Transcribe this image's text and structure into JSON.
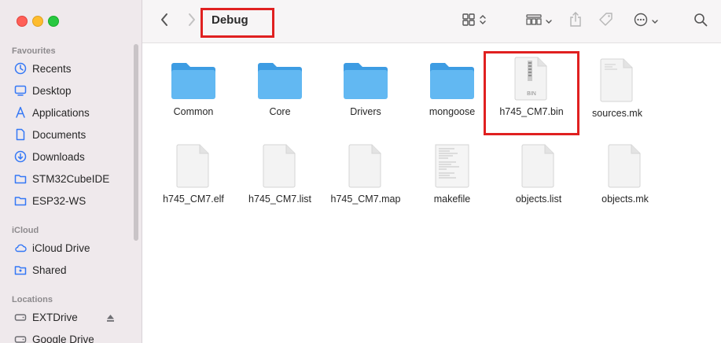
{
  "window": {
    "title": "Debug"
  },
  "sidebar": {
    "favourites_title": "Favourites",
    "favourites": [
      {
        "label": "Recents",
        "icon": "clock-icon"
      },
      {
        "label": "Desktop",
        "icon": "desktop-icon"
      },
      {
        "label": "Applications",
        "icon": "applications-icon"
      },
      {
        "label": "Documents",
        "icon": "document-icon"
      },
      {
        "label": "Downloads",
        "icon": "downloads-icon"
      },
      {
        "label": "STM32CubeIDE",
        "icon": "folder-icon"
      },
      {
        "label": "ESP32-WS",
        "icon": "folder-icon"
      }
    ],
    "icloud_title": "iCloud",
    "icloud": [
      {
        "label": "iCloud Drive",
        "icon": "cloud-icon"
      },
      {
        "label": "Shared",
        "icon": "shared-folder-icon"
      }
    ],
    "locations_title": "Locations",
    "locations": [
      {
        "label": "EXTDrive",
        "icon": "drive-icon"
      },
      {
        "label": "Google Drive",
        "icon": "drive-icon"
      }
    ]
  },
  "files": [
    {
      "name": "Common",
      "type": "folder"
    },
    {
      "name": "Core",
      "type": "folder"
    },
    {
      "name": "Drivers",
      "type": "folder"
    },
    {
      "name": "mongoose",
      "type": "folder"
    },
    {
      "name": "h745_CM7.bin",
      "type": "archive",
      "badge": "BIN"
    },
    {
      "name": "sources.mk",
      "type": "text"
    },
    {
      "name": "h745_CM7.elf",
      "type": "blank"
    },
    {
      "name": "h745_CM7.list",
      "type": "blank"
    },
    {
      "name": "h745_CM7.map",
      "type": "blank"
    },
    {
      "name": "makefile",
      "type": "text"
    },
    {
      "name": "objects.list",
      "type": "blank"
    },
    {
      "name": "objects.mk",
      "type": "blank"
    }
  ],
  "colors": {
    "accent": "#3478f6",
    "folder": "#5ab4f0",
    "highlight": "#e02020",
    "sidebar_bg": "#efe9ec"
  }
}
